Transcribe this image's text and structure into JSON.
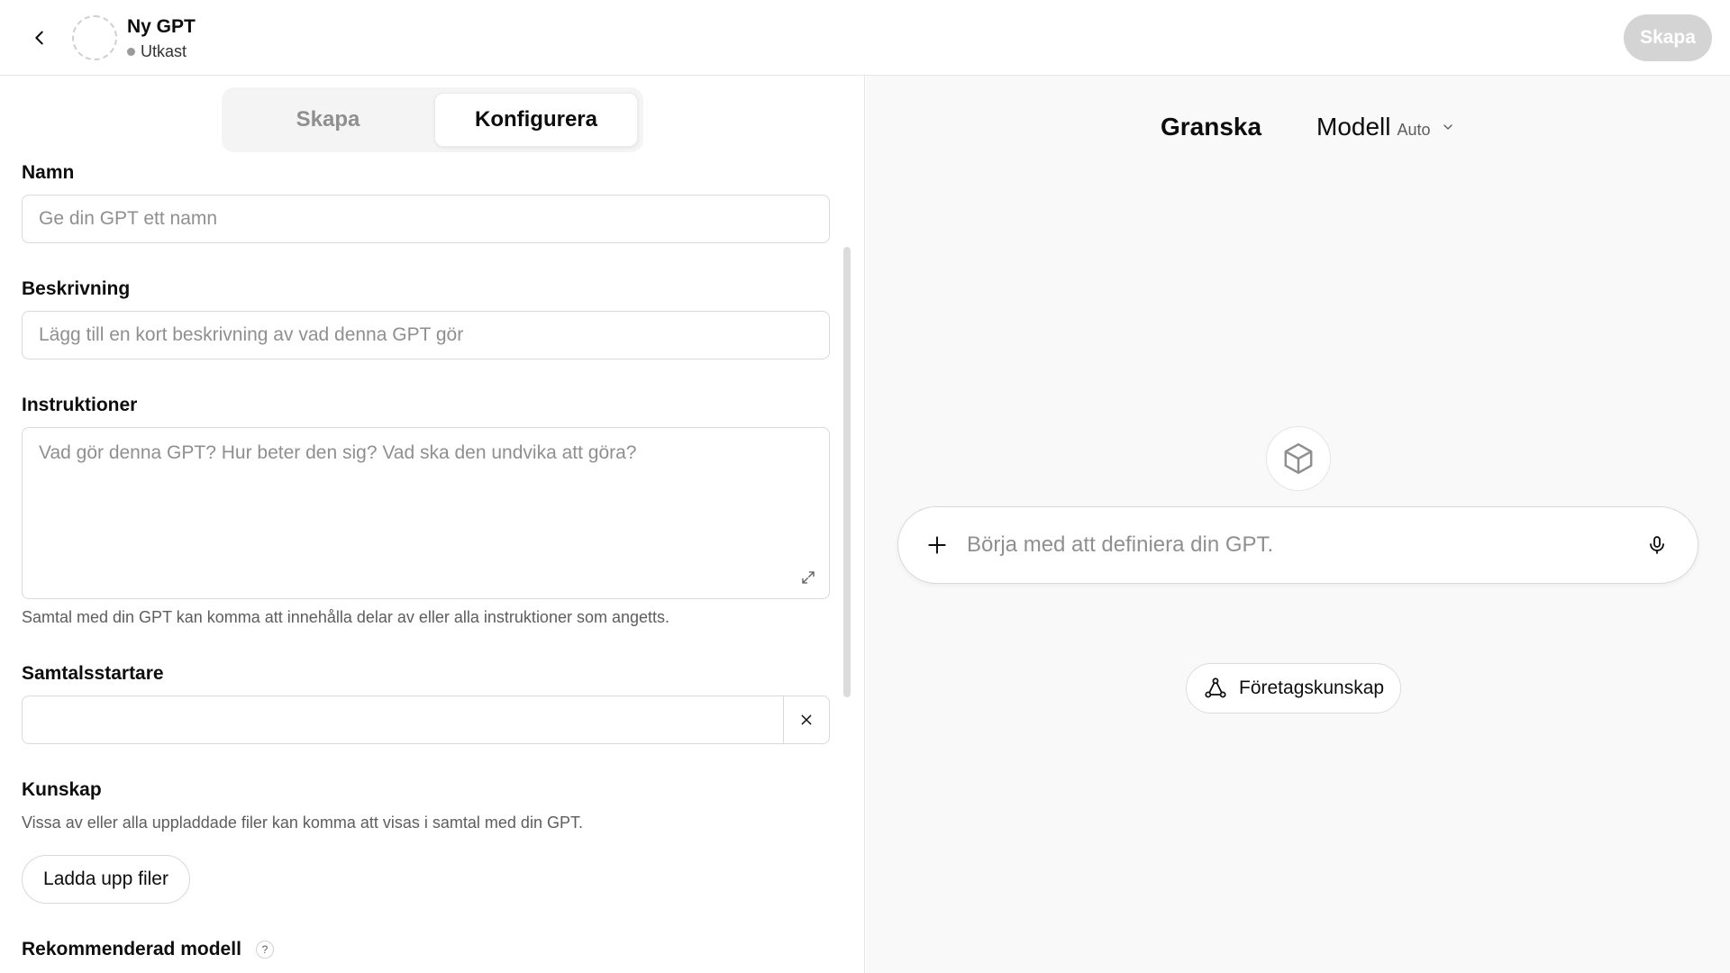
{
  "header": {
    "gpt_name": "Ny GPT",
    "status": "Utkast",
    "create_button": "Skapa"
  },
  "tabs": [
    {
      "label": "Skapa",
      "active": false
    },
    {
      "label": "Konfigurera",
      "active": true
    }
  ],
  "form": {
    "name_label": "Namn",
    "name_placeholder": "Ge din GPT ett namn",
    "description_label": "Beskrivning",
    "description_placeholder": "Lägg till en kort beskrivning av vad denna GPT gör",
    "instructions_label": "Instruktioner",
    "instructions_placeholder": "Vad gör denna GPT? Hur beter den sig? Vad ska den undvika att göra?",
    "instructions_helper": "Samtal med din GPT kan komma att innehålla delar av eller alla instruktioner som angetts.",
    "starters_label": "Samtalsstartare",
    "knowledge_label": "Kunskap",
    "knowledge_helper": "Vissa av eller alla uppladdade filer kan komma att visas i samtal med din GPT.",
    "upload_button": "Ladda upp filer",
    "recommended_model_label": "Rekommenderad modell",
    "help_glyph": "?"
  },
  "preview": {
    "title": "Granska",
    "model_label": "Modell",
    "model_value": "Auto",
    "composer_placeholder": "Börja med att definiera din GPT.",
    "knowledge_pill": "Företagskunskap"
  },
  "colors": {
    "accent_disabled": "#d4d4d4",
    "border": "#d9d9d9",
    "placeholder": "#8f8f8f",
    "preview_bg": "#f9f9f9"
  }
}
